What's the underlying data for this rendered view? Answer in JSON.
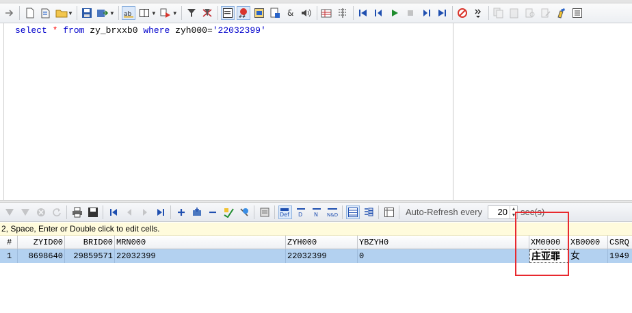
{
  "toolbar": {
    "icons": [
      "new-doc-icon",
      "open-script-icon",
      "open-folder-icon",
      "save-icon",
      "save-as-icon",
      "abc-active-icon",
      "layout-icon",
      "run-script-icon",
      "filter-icon",
      "funnel-cross-icon",
      "grid-select-icon",
      "stop-record-icon",
      "format-icon",
      "explain-icon",
      "ampersand-icon",
      "speaker-icon",
      "table-icon",
      "sort-icon",
      "first-icon",
      "prev-icon",
      "play-icon",
      "stop-icon",
      "next-icon",
      "last-icon",
      "no-entry-icon",
      "more-icon",
      "copy-icon",
      "paste-icon",
      "find-icon",
      "replace-icon",
      "highlight-icon",
      "list-icon"
    ]
  },
  "editor": {
    "sql": {
      "kw_select": "select",
      "star": "*",
      "kw_from": "from",
      "table": "zy_brxxb0",
      "kw_where": "where",
      "cond_col": "zyh000=",
      "cond_val": "'22032399'"
    }
  },
  "grid_toolbar": {
    "auto_refresh_label": "Auto-Refresh every",
    "interval": "20",
    "unit": "sec(s)"
  },
  "hint": "2, Space, Enter or Double click to edit cells.",
  "grid": {
    "headers": [
      "#",
      "ZYID00",
      "BRID00",
      "MRN000",
      "ZYH000",
      "YBZYH0",
      "XM0000",
      "XB0000",
      "CSRQ"
    ],
    "rows": [
      {
        "num": "1",
        "ZYID00": "8698640",
        "BRID00": "29859571",
        "MRN000": "22032399",
        "ZYH000": "22032399",
        "YBZYH0": "0",
        "XM0000": "庄亚罪",
        "XB0000": "女",
        "CSRQ": "1949"
      }
    ]
  },
  "colors": {
    "selected_row": "#b3d1f0",
    "hint_bg": "#fffbdc",
    "annotation": "#e8282e",
    "keyword": "#0000cc"
  }
}
